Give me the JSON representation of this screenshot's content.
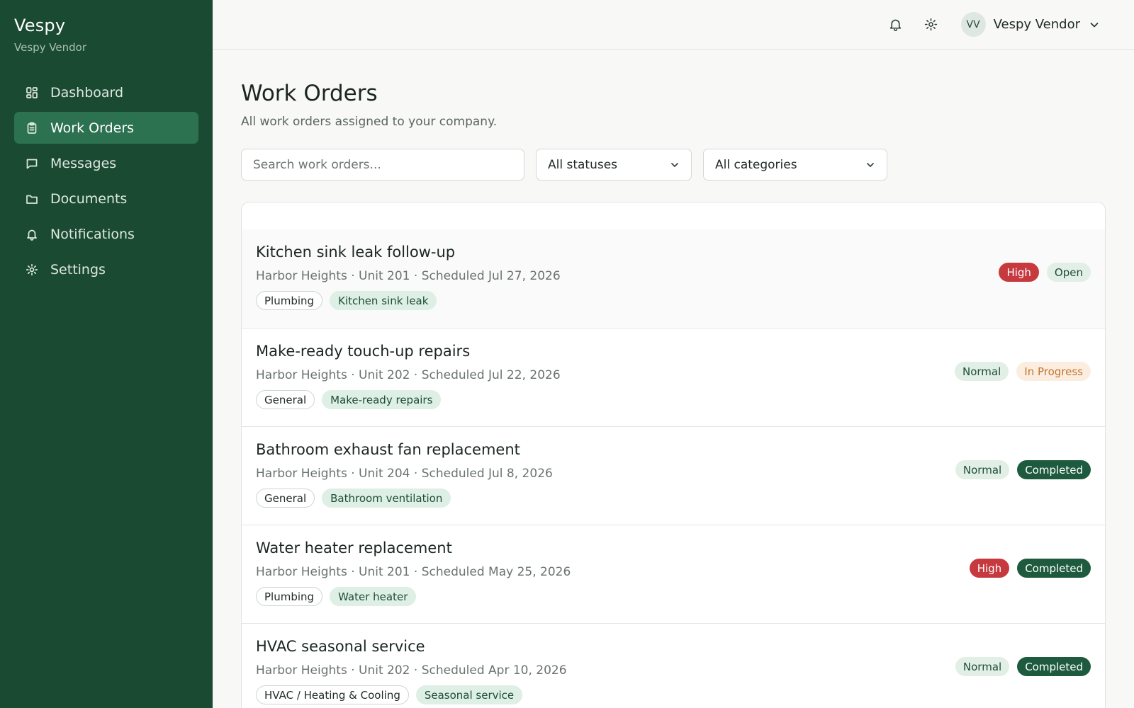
{
  "sidebar": {
    "brand": "Vespy",
    "brand_sub": "Vespy Vendor",
    "items": [
      {
        "label": "Dashboard",
        "icon": "dashboard-icon"
      },
      {
        "label": "Work Orders",
        "icon": "clipboard-icon",
        "active": true
      },
      {
        "label": "Messages",
        "icon": "message-icon"
      },
      {
        "label": "Documents",
        "icon": "folder-icon"
      },
      {
        "label": "Notifications",
        "icon": "bell-icon"
      },
      {
        "label": "Settings",
        "icon": "gear-icon"
      }
    ]
  },
  "topbar": {
    "avatar_initials": "VV",
    "user_name": "Vespy Vendor"
  },
  "page": {
    "title": "Work Orders",
    "subtitle": "All work orders assigned to your company."
  },
  "filters": {
    "search_placeholder": "Search work orders...",
    "status_value": "All statuses",
    "category_value": "All categories"
  },
  "work_orders": [
    {
      "title": "Kitchen sink leak follow-up",
      "meta": "Harbor Heights · Unit 201 · Scheduled Jul 27, 2026",
      "category": "Plumbing",
      "type": "Kitchen sink leak",
      "priority": "High",
      "status": "Open"
    },
    {
      "title": "Make-ready touch-up repairs",
      "meta": "Harbor Heights · Unit 202 · Scheduled Jul 22, 2026",
      "category": "General",
      "type": "Make-ready repairs",
      "priority": "Normal",
      "status": "In Progress"
    },
    {
      "title": "Bathroom exhaust fan replacement",
      "meta": "Harbor Heights · Unit 204 · Scheduled Jul 8, 2026",
      "category": "General",
      "type": "Bathroom ventilation",
      "priority": "Normal",
      "status": "Completed"
    },
    {
      "title": "Water heater replacement",
      "meta": "Harbor Heights · Unit 201 · Scheduled May 25, 2026",
      "category": "Plumbing",
      "type": "Water heater",
      "priority": "High",
      "status": "Completed"
    },
    {
      "title": "HVAC seasonal service",
      "meta": "Harbor Heights · Unit 202 · Scheduled Apr 10, 2026",
      "category": "HVAC / Heating & Cooling",
      "type": "Seasonal service",
      "priority": "Normal",
      "status": "Completed"
    }
  ],
  "colors": {
    "sidebar_bg": "#1b4a33",
    "active_nav": "#2c7150",
    "high": "#c63a3f",
    "completed": "#1d5a3e",
    "in_progress_text": "#c4732e"
  }
}
